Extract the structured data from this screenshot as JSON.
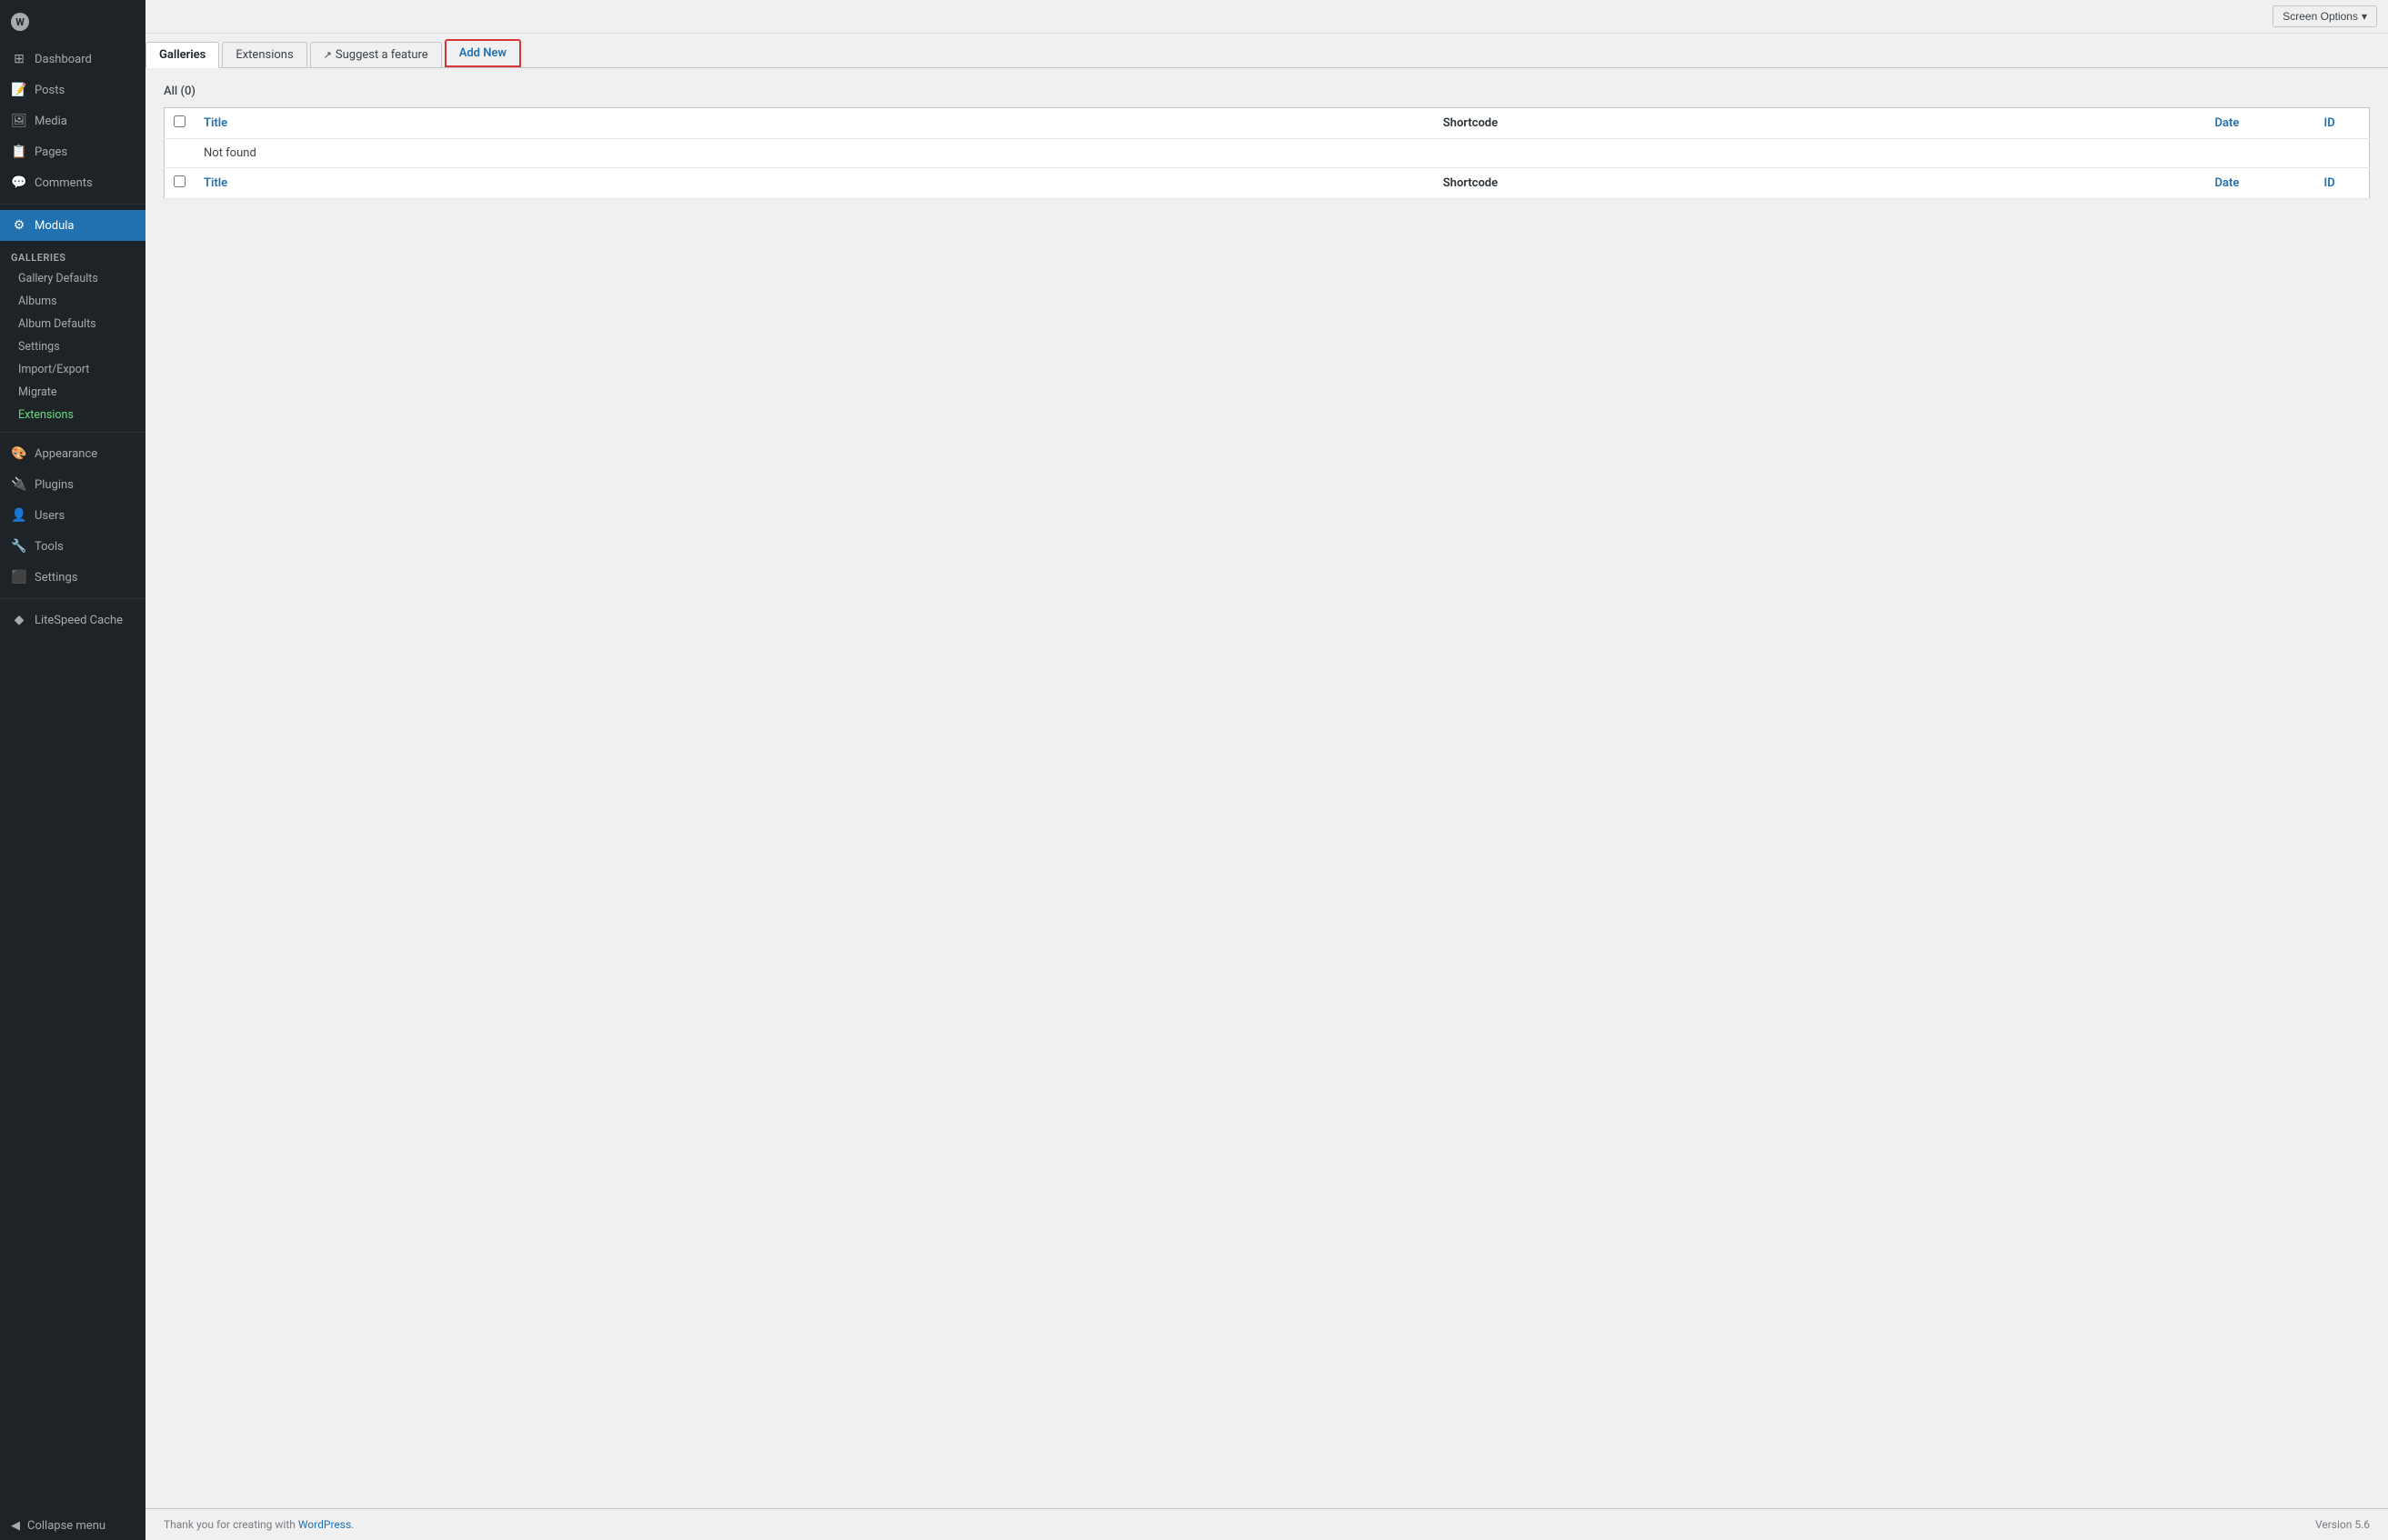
{
  "sidebar": {
    "items": [
      {
        "id": "dashboard",
        "label": "Dashboard",
        "icon": "⊞"
      },
      {
        "id": "posts",
        "label": "Posts",
        "icon": "📄"
      },
      {
        "id": "media",
        "label": "Media",
        "icon": "🖼"
      },
      {
        "id": "pages",
        "label": "Pages",
        "icon": "📋"
      },
      {
        "id": "comments",
        "label": "Comments",
        "icon": "💬"
      },
      {
        "id": "modula",
        "label": "Modula",
        "icon": "⚙",
        "active": true
      }
    ],
    "modula_sub": [
      {
        "id": "galleries",
        "label": "Galleries",
        "active_section": true
      },
      {
        "id": "gallery-defaults",
        "label": "Gallery Defaults"
      },
      {
        "id": "albums",
        "label": "Albums"
      },
      {
        "id": "album-defaults",
        "label": "Album Defaults"
      },
      {
        "id": "settings",
        "label": "Settings"
      },
      {
        "id": "import-export",
        "label": "Import/Export"
      },
      {
        "id": "migrate",
        "label": "Migrate"
      },
      {
        "id": "extensions",
        "label": "Extensions",
        "green": true
      }
    ],
    "bottom_items": [
      {
        "id": "appearance",
        "label": "Appearance",
        "icon": "🎨"
      },
      {
        "id": "plugins",
        "label": "Plugins",
        "icon": "🔌"
      },
      {
        "id": "users",
        "label": "Users",
        "icon": "👤"
      },
      {
        "id": "tools",
        "label": "Tools",
        "icon": "🔧"
      },
      {
        "id": "settings",
        "label": "Settings",
        "icon": "⬛"
      }
    ],
    "extra_items": [
      {
        "id": "litespeed",
        "label": "LiteSpeed Cache",
        "icon": "◆"
      }
    ],
    "collapse_label": "Collapse menu"
  },
  "top_bar": {
    "screen_options_label": "Screen Options",
    "screen_options_arrow": "▾"
  },
  "tabs": [
    {
      "id": "galleries",
      "label": "Galleries",
      "active": true,
      "external": false
    },
    {
      "id": "extensions",
      "label": "Extensions",
      "active": false,
      "external": false
    },
    {
      "id": "suggest",
      "label": "Suggest a feature",
      "active": false,
      "external": true
    },
    {
      "id": "add-new",
      "label": "Add New",
      "active": false,
      "special": true
    }
  ],
  "filter": {
    "all_label": "All",
    "count": "(0)"
  },
  "table": {
    "header": {
      "title": "Title",
      "shortcode": "Shortcode",
      "date": "Date",
      "id": "ID"
    },
    "not_found_message": "Not found",
    "footer_row": {
      "title": "Title",
      "shortcode": "Shortcode",
      "date": "Date",
      "id": "ID"
    }
  },
  "footer": {
    "thank_you_text": "Thank you for creating with",
    "wordpress_link": "WordPress",
    "version_label": "Version 5.6"
  }
}
